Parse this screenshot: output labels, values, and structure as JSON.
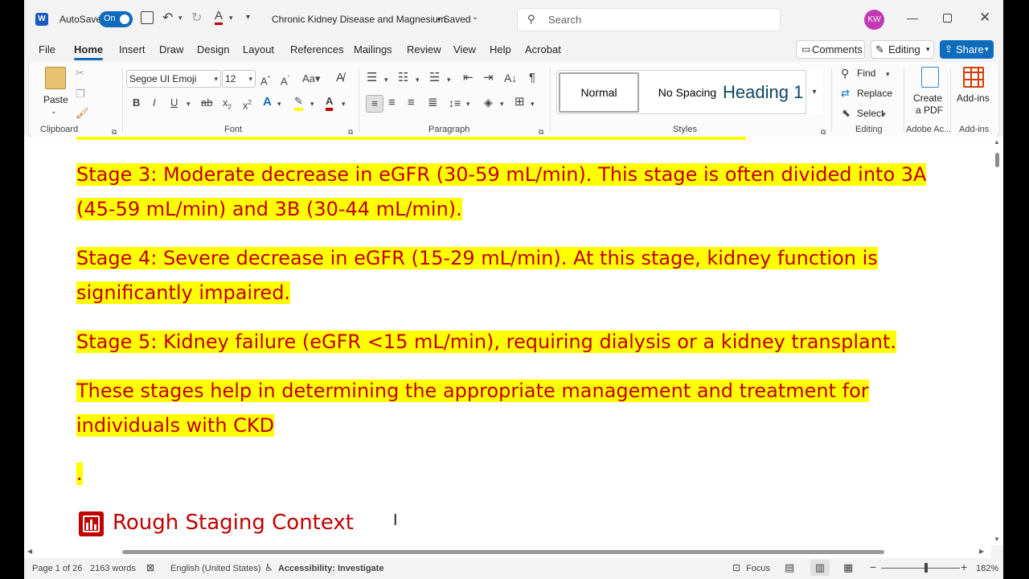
{
  "titlebar": {
    "autosave_label": "AutoSave",
    "autosave_state": "On",
    "doc_title": "Chronic Kidney Disease and Magnesium",
    "save_state": "• Saved",
    "search_placeholder": "Search",
    "user_initials": "KW"
  },
  "menu": {
    "tabs": [
      "File",
      "Home",
      "Insert",
      "Draw",
      "Design",
      "Layout",
      "References",
      "Mailings",
      "Review",
      "View",
      "Help",
      "Acrobat"
    ],
    "comments_label": "Comments",
    "editing_label": "Editing",
    "share_label": "Share"
  },
  "ribbon": {
    "clipboard": {
      "paste_label": "Paste",
      "group_label": "Clipboard"
    },
    "font": {
      "font_name": "Segoe UI Emoji",
      "font_size": "12",
      "group_label": "Font"
    },
    "paragraph": {
      "group_label": "Paragraph"
    },
    "styles": {
      "normal": "Normal",
      "no_spacing": "No Spacing",
      "heading": "Heading 1",
      "group_label": "Styles"
    },
    "editing": {
      "find": "Find",
      "replace": "Replace",
      "select": "Select",
      "group_label": "Editing"
    },
    "adobe": {
      "create_pdf_line1": "Create",
      "create_pdf_line2": "a PDF",
      "group_label": "Adobe Ac..."
    },
    "addins": {
      "label": "Add-ins",
      "group_label": "Add-ins"
    }
  },
  "document": {
    "paragraphs": [
      {
        "lines": [
          "Stage 3: Moderate decrease in eGFR (30-59 mL/min). This stage is often divided into 3A",
          "(45-59 mL/min) and 3B (30-44 mL/min)."
        ]
      },
      {
        "lines": [
          "Stage 4: Severe decrease in eGFR (15-29 mL/min). At this stage, kidney function is",
          "significantly impaired."
        ]
      },
      {
        "lines": [
          "Stage 5: Kidney failure (eGFR <15 mL/min), requiring dialysis or a kidney transplant."
        ]
      },
      {
        "lines": [
          "These stages help in determining the appropriate management and treatment for",
          "individuals with CKD"
        ]
      },
      {
        "lines": [
          "."
        ]
      }
    ],
    "section_heading": "Rough Staging Context"
  },
  "status": {
    "page": "Page 1 of 26",
    "words": "2163 words",
    "language": "English (United States)",
    "accessibility": "Accessibility: Investigate",
    "focus": "Focus",
    "zoom": "182%"
  },
  "colors": {
    "accent": "#0f6cbd",
    "doc_text": "#c00000",
    "highlight": "#ffff00"
  }
}
